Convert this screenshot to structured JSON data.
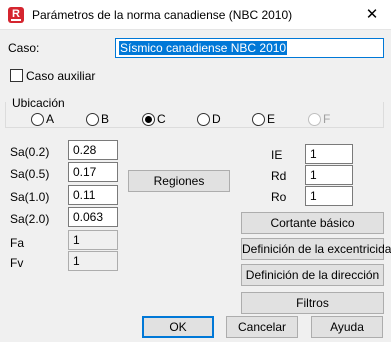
{
  "window": {
    "title": "Parámetros de la norma canadiense (NBC 2010)",
    "app_icon": "R",
    "close_glyph": "✕"
  },
  "caso": {
    "label": "Caso:",
    "value": "Sísmico canadiense NBC 2010"
  },
  "caso_auxiliar": {
    "label": "Caso auxiliar",
    "checked": false
  },
  "ubicacion": {
    "title": "Ubicación",
    "options": [
      {
        "label": "A",
        "checked": false,
        "enabled": true
      },
      {
        "label": "B",
        "checked": false,
        "enabled": true
      },
      {
        "label": "C",
        "checked": true,
        "enabled": true
      },
      {
        "label": "D",
        "checked": false,
        "enabled": true
      },
      {
        "label": "E",
        "checked": false,
        "enabled": true
      },
      {
        "label": "F",
        "checked": false,
        "enabled": false
      }
    ]
  },
  "sa_params": [
    {
      "label": "Sa(0.2)",
      "value": "0.28"
    },
    {
      "label": "Sa(0.5)",
      "value": "0.17"
    },
    {
      "label": "Sa(1.0)",
      "value": "0.11"
    },
    {
      "label": "Sa(2.0)",
      "value": "0.063"
    }
  ],
  "site_params": [
    {
      "label": "Fa",
      "value": "1"
    },
    {
      "label": "Fv",
      "value": "1"
    }
  ],
  "factors": [
    {
      "label": "IE",
      "value": "1"
    },
    {
      "label": "Rd",
      "value": "1"
    },
    {
      "label": "Ro",
      "value": "1"
    }
  ],
  "buttons": {
    "regiones": "Regiones",
    "cortante": "Cortante básico",
    "excentricidad": "Definición de la excentricidad",
    "direccion": "Definición de la dirección",
    "filtros": "Filtros",
    "ok": "OK",
    "cancelar": "Cancelar",
    "ayuda": "Ayuda"
  },
  "colors": {
    "accent": "#0078d7",
    "app_icon": "#d5252f",
    "dialog_bg": "#f0f0f0"
  }
}
